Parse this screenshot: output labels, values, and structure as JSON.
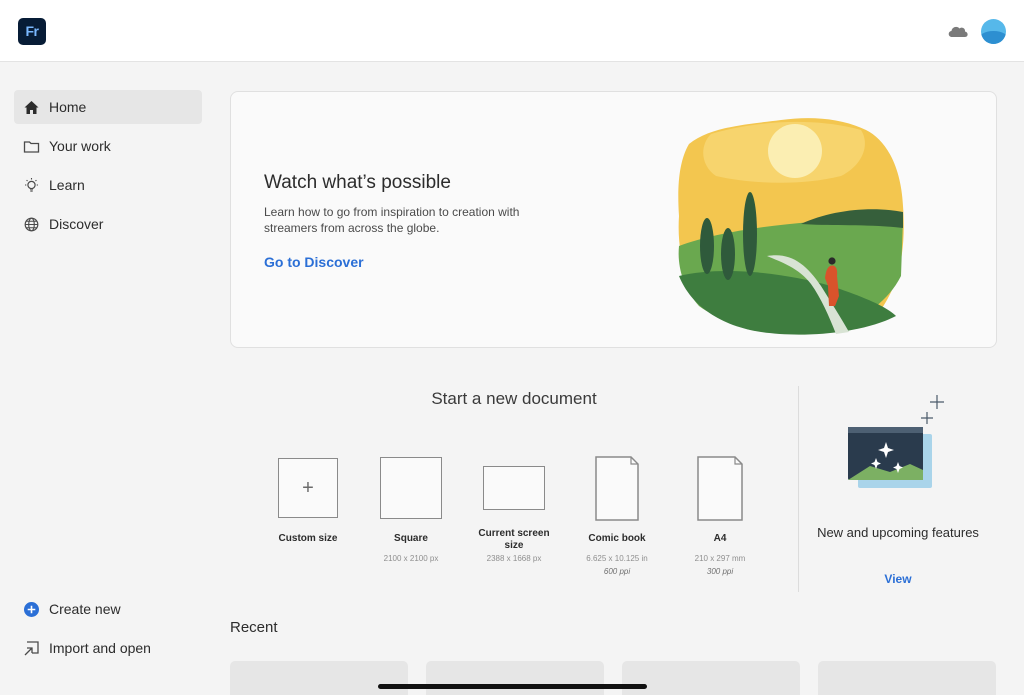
{
  "app": {
    "logo_text": "Fr"
  },
  "header": {
    "cloud_icon": "cloud-icon",
    "avatar": "user-avatar"
  },
  "sidebar": {
    "items": [
      {
        "label": "Home",
        "icon": "home-icon",
        "active": true
      },
      {
        "label": "Your work",
        "icon": "folder-icon"
      },
      {
        "label": "Learn",
        "icon": "lightbulb-icon"
      },
      {
        "label": "Discover",
        "icon": "globe-icon"
      }
    ],
    "bottom": [
      {
        "label": "Create new",
        "icon": "plus-circle-icon"
      },
      {
        "label": "Import and open",
        "icon": "import-icon"
      }
    ]
  },
  "banner": {
    "title": "Watch what’s possible",
    "description": "Learn how to go from inspiration to creation with streamers from across the globe.",
    "link": "Go to Discover"
  },
  "new_document": {
    "title": "Start a new document",
    "presets": [
      {
        "label": "Custom size",
        "size": "",
        "ppi": ""
      },
      {
        "label": "Square",
        "size": "2100 x 2100 px",
        "ppi": ""
      },
      {
        "label": "Current screen size",
        "size": "2388 x 1668 px",
        "ppi": ""
      },
      {
        "label": "Comic book",
        "size": "6.625 x 10.125 in",
        "ppi": "600 ppi"
      },
      {
        "label": "A4",
        "size": "210 x 297 mm",
        "ppi": "300 ppi"
      }
    ]
  },
  "features": {
    "title": "New and upcoming features",
    "link": "View"
  },
  "recent": {
    "title": "Recent"
  },
  "colors": {
    "accent": "#2b6fd6",
    "logo_bg": "#071c36",
    "logo_text": "#7ab8ff"
  }
}
